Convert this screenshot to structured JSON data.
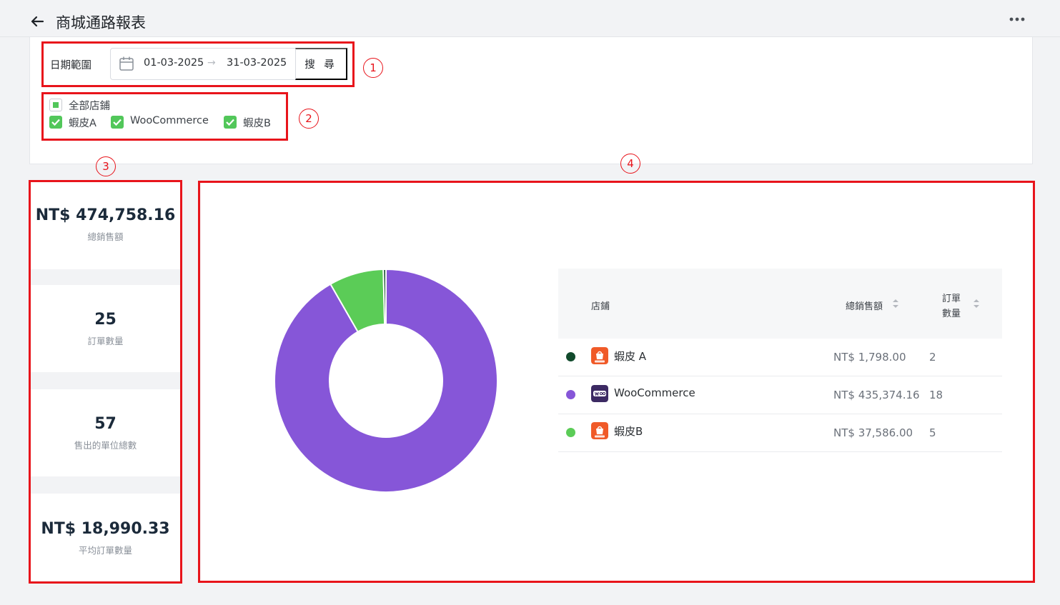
{
  "header": {
    "title": "商城通路報表"
  },
  "filters": {
    "date_label": "日期範圍",
    "date_start": "01-03-2025",
    "date_arrow": "→",
    "date_end": "31-03-2025",
    "search_label": "搜 尋",
    "all_stores_label": "全部店鋪",
    "stores": [
      {
        "label": "蝦皮A",
        "checked": true
      },
      {
        "label": "WooCommerce",
        "checked": true
      },
      {
        "label": "蝦皮B",
        "checked": true
      }
    ]
  },
  "kpis": [
    {
      "value": "NT$ 474,758.16",
      "label": "總銷售額"
    },
    {
      "value": "25",
      "label": "訂單數量"
    },
    {
      "value": "57",
      "label": "售出的單位總數"
    },
    {
      "value": "NT$ 18,990.33",
      "label": "平均訂單數量"
    }
  ],
  "table": {
    "col_store": "店鋪",
    "col_sales": "總銷售額",
    "col_orders_line1": "訂單",
    "col_orders_line2": "數量",
    "rows": [
      {
        "name": "蝦皮 A",
        "sales": "NT$ 1,798.00",
        "orders": "2",
        "color": "#114a2c",
        "logo": "shopee-logo"
      },
      {
        "name": "WooCommerce",
        "sales": "NT$ 435,374.16",
        "orders": "18",
        "color": "#8656d8",
        "logo": "woocommerce-logo"
      },
      {
        "name": "蝦皮B",
        "sales": "NT$ 37,586.00",
        "orders": "5",
        "color": "#5bcc57",
        "logo": "shopee-logo"
      }
    ]
  },
  "chart_data": {
    "type": "pie",
    "variant": "donut",
    "categories": [
      "蝦皮 A",
      "WooCommerce",
      "蝦皮B"
    ],
    "values": [
      1798.0,
      435374.16,
      37586.0
    ],
    "colors": [
      "#114a2c",
      "#8656d8",
      "#5bcc57"
    ]
  },
  "annotations": [
    "1",
    "2",
    "3",
    "4"
  ],
  "colors": {
    "accent_green": "#52c75a",
    "annotation_red": "#e8141b",
    "shopee_orange": "#f05a28",
    "woo_purple": "#3c2a63"
  }
}
